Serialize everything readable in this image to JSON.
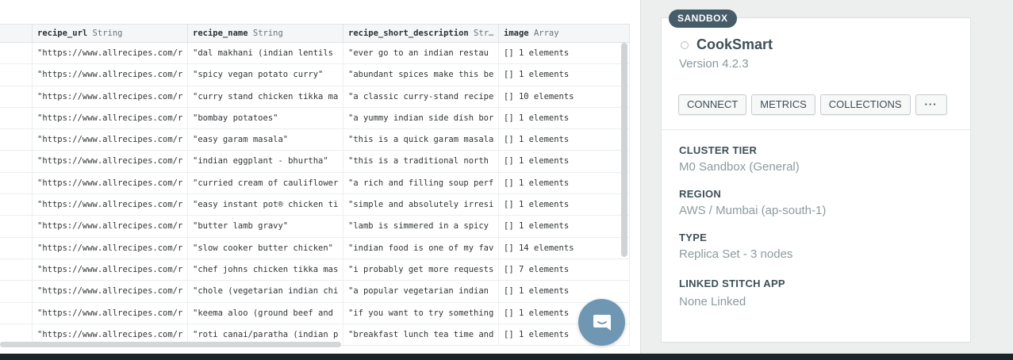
{
  "table": {
    "columns": [
      {
        "field": "",
        "type": ""
      },
      {
        "field": "recipe_url",
        "type": "String"
      },
      {
        "field": "recipe_name",
        "type": "String"
      },
      {
        "field": "recipe_short_description",
        "type": "Str…"
      },
      {
        "field": "image",
        "type": "Array"
      }
    ],
    "rows": [
      {
        "url": "\"https://www.allrecipes.com/r",
        "name": "\"dal makhani (indian lentils",
        "desc": "\"ever go to an indian restau",
        "image": "[] 1 elements"
      },
      {
        "url": "\"https://www.allrecipes.com/r",
        "name": "\"spicy vegan potato curry\"",
        "desc": "\"abundant spices make this be",
        "image": "[] 1 elements"
      },
      {
        "url": "\"https://www.allrecipes.com/r",
        "name": "\"curry stand chicken tikka ma",
        "desc": "\"a classic curry-stand recipe",
        "image": "[] 10 elements"
      },
      {
        "url": "\"https://www.allrecipes.com/r",
        "name": "\"bombay potatoes\"",
        "desc": "\"a yummy indian side dish bor",
        "image": "[] 1 elements"
      },
      {
        "url": "\"https://www.allrecipes.com/r",
        "name": "\"easy garam masala\"",
        "desc": "\"this is a quick garam masala",
        "image": "[] 1 elements"
      },
      {
        "url": "\"https://www.allrecipes.com/r",
        "name": "\"indian eggplant - bhurtha\"",
        "desc": "\"this is a traditional north",
        "image": "[] 1 elements"
      },
      {
        "url": "\"https://www.allrecipes.com/r",
        "name": "\"curried cream of cauliflower",
        "desc": "\"a rich and filling soup perf",
        "image": "[] 1 elements"
      },
      {
        "url": "\"https://www.allrecipes.com/r",
        "name": "\"easy instant pot® chicken ti",
        "desc": "\"simple and absolutely irresi",
        "image": "[] 1 elements"
      },
      {
        "url": "\"https://www.allrecipes.com/r",
        "name": "\"butter lamb gravy\"",
        "desc": "\"lamb is simmered in a spicy",
        "image": "[] 1 elements"
      },
      {
        "url": "\"https://www.allrecipes.com/r",
        "name": "\"slow cooker butter chicken\"",
        "desc": "\"indian food is one of my fav",
        "image": "[] 14 elements"
      },
      {
        "url": "\"https://www.allrecipes.com/r",
        "name": "\"chef johns chicken tikka mas",
        "desc": "\"i probably get more requests",
        "image": "[] 7 elements"
      },
      {
        "url": "\"https://www.allrecipes.com/r",
        "name": "\"chole (vegetarian indian chi",
        "desc": "\"a popular vegetarian indian",
        "image": "[] 1 elements"
      },
      {
        "url": "\"https://www.allrecipes.com/r",
        "name": "\"keema aloo (ground beef and",
        "desc": "\"if you want to try something",
        "image": "[] 1 elements"
      },
      {
        "url": "\"https://www.allrecipes.com/r",
        "name": "\"roti canai/paratha (indian p",
        "desc": "\"breakfast lunch tea time and",
        "image": "[] 1 elements"
      }
    ]
  },
  "cluster": {
    "badge": "SANDBOX",
    "name": "CookSmart",
    "version": "Version 4.2.3",
    "buttons": {
      "connect": "CONNECT",
      "metrics": "METRICS",
      "collections": "COLLECTIONS",
      "more": "···"
    },
    "tier_label": "CLUSTER TIER",
    "tier_value": "M0 Sandbox (General)",
    "region_label": "REGION",
    "region_value": "AWS / Mumbai (ap-south-1)",
    "type_label": "TYPE",
    "type_value": "Replica Set - 3 nodes",
    "stitch_label": "LINKED STITCH APP",
    "stitch_value": "None Linked"
  },
  "colors": {
    "badge_bg": "#475c69",
    "chat_button": "#6f97b3",
    "label_text": "#3d4f58",
    "value_text": "#8d9a9e"
  },
  "icons": {
    "chat": "chat-bubble-icon",
    "status": "status-circle-icon"
  }
}
